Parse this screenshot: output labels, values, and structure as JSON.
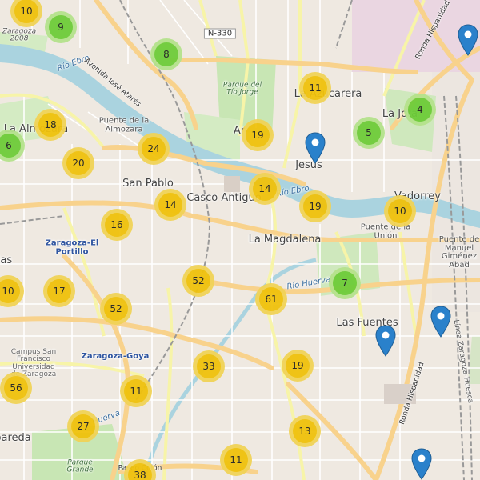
{
  "colors": {
    "land": "#efe9e1",
    "river": "#aad3df",
    "park": "#c8e6b4",
    "road_major": "#f8d28c",
    "road_yellow": "#f7f4a8",
    "road_minor": "#ffffff",
    "rail": "#888888",
    "cluster_yellow_outer": "#f1d357",
    "cluster_yellow_inner": "#f0c20c",
    "cluster_green_outer": "#b5e28c",
    "cluster_green_inner": "#6ecc39",
    "marker_blue": "#2a81cb"
  },
  "labels": {
    "la_almozara": "La Almozara",
    "san_pablo": "San Pablo",
    "casco_antiguo": "Casco Antiguo",
    "la_magdalena": "La Magdalena",
    "las_fuentes": "Las Fuentes",
    "la_jota": "La Jota",
    "vadorrey": "Vadorrey",
    "la_azucarera": "La Azucarera",
    "jesus": "Jesús",
    "parede": "pareda",
    "delicias": "ias",
    "arrabal": "Ar",
    "rio_ebro_1": "Río Ebro",
    "rio_ebro_2": "Río Ebro",
    "rio_huerva": "Río Huerva",
    "huerva_lower": "Huerva",
    "zaragoza_2008": "Zaragoza 2008",
    "avenida": "Avenida José Atarés",
    "puente_almozara": "Puente de la Almozara",
    "puente_union": "Puente de la Unión",
    "puente_manuel": "Puente de Manuel Giménez Abad",
    "parque_tio_jorge": "Parque del Tío Jorge",
    "station_portillo": "Zaragoza-El Portillo",
    "station_goya": "Zaragoza-Goya",
    "campus": "Campus San Francisco Universidad de Zaragoza",
    "ronda_hispanidad_top": "Ronda Hispanidad",
    "ronda_hispanidad_bottom": "Ronda Hispanidad",
    "linea_huesca": "Línea Zaragoza-Huesca",
    "parque_grande": "Parque Grande",
    "paseo_colon": "Paseo Colón",
    "road_n330": "N-330"
  },
  "clusters": [
    {
      "count": "10",
      "kind": "yellow"
    },
    {
      "count": "9",
      "kind": "green"
    },
    {
      "count": "8",
      "kind": "green"
    },
    {
      "count": "11",
      "kind": "yellow"
    },
    {
      "count": "4",
      "kind": "green"
    },
    {
      "count": "5",
      "kind": "green"
    },
    {
      "count": "18",
      "kind": "yellow"
    },
    {
      "count": "6",
      "kind": "green"
    },
    {
      "count": "19",
      "kind": "yellow"
    },
    {
      "count": "24",
      "kind": "yellow"
    },
    {
      "count": "20",
      "kind": "yellow"
    },
    {
      "count": "14",
      "kind": "yellow"
    },
    {
      "count": "14",
      "kind": "yellow"
    },
    {
      "count": "19",
      "kind": "yellow"
    },
    {
      "count": "10",
      "kind": "yellow"
    },
    {
      "count": "16",
      "kind": "yellow"
    },
    {
      "count": "52",
      "kind": "yellow"
    },
    {
      "count": "7",
      "kind": "green"
    },
    {
      "count": "10",
      "kind": "yellow"
    },
    {
      "count": "17",
      "kind": "yellow"
    },
    {
      "count": "61",
      "kind": "yellow"
    },
    {
      "count": "52",
      "kind": "yellow"
    },
    {
      "count": "33",
      "kind": "yellow"
    },
    {
      "count": "19",
      "kind": "yellow"
    },
    {
      "count": "11",
      "kind": "yellow"
    },
    {
      "count": "56",
      "kind": "yellow"
    },
    {
      "count": "27",
      "kind": "yellow"
    },
    {
      "count": "13",
      "kind": "yellow"
    },
    {
      "count": "11",
      "kind": "yellow"
    },
    {
      "count": "38",
      "kind": "yellow"
    }
  ],
  "markers_count": 5
}
